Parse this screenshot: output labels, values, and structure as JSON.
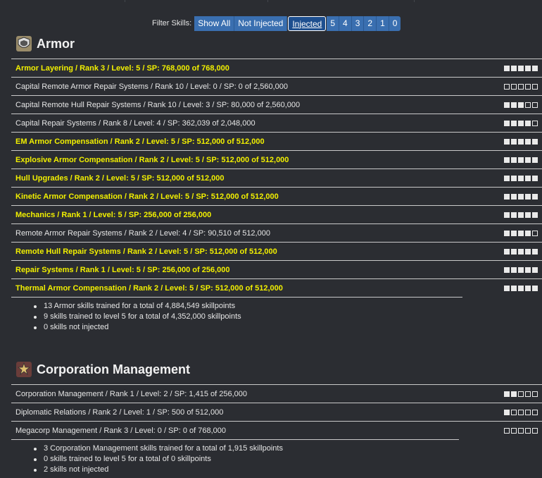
{
  "filter": {
    "label": "Filter Skills:",
    "buttons": [
      {
        "label": "Show All",
        "active": false
      },
      {
        "label": "Not Injected",
        "active": false
      },
      {
        "label": "Injected",
        "active": true
      },
      {
        "label": "5",
        "active": false
      },
      {
        "label": "4",
        "active": false
      },
      {
        "label": "3",
        "active": false
      },
      {
        "label": "2",
        "active": false
      },
      {
        "label": "1",
        "active": false
      },
      {
        "label": "0",
        "active": false
      }
    ]
  },
  "sections": [
    {
      "title": "Armor",
      "icon": "armor-plate-icon",
      "skills": [
        {
          "text": "Armor Layering / Rank 3 / Level: 5 / SP: 768,000 of 768,000",
          "level": 5,
          "complete": true
        },
        {
          "text": "Capital Remote Armor Repair Systems / Rank 10 / Level: 0 / SP: 0 of 2,560,000",
          "level": 0,
          "complete": false
        },
        {
          "text": "Capital Remote Hull Repair Systems / Rank 10 / Level: 3 / SP: 80,000 of 2,560,000",
          "level": 3,
          "complete": false
        },
        {
          "text": "Capital Repair Systems / Rank 8 / Level: 4 / SP: 362,039 of 2,048,000",
          "level": 4,
          "complete": false
        },
        {
          "text": "EM Armor Compensation / Rank 2 / Level: 5 / SP: 512,000 of 512,000",
          "level": 5,
          "complete": true
        },
        {
          "text": "Explosive Armor Compensation / Rank 2 / Level: 5 / SP: 512,000 of 512,000",
          "level": 5,
          "complete": true
        },
        {
          "text": "Hull Upgrades / Rank 2 / Level: 5 / SP: 512,000 of 512,000",
          "level": 5,
          "complete": true
        },
        {
          "text": "Kinetic Armor Compensation / Rank 2 / Level: 5 / SP: 512,000 of 512,000",
          "level": 5,
          "complete": true
        },
        {
          "text": "Mechanics / Rank 1 / Level: 5 / SP: 256,000 of 256,000",
          "level": 5,
          "complete": true
        },
        {
          "text": "Remote Armor Repair Systems / Rank 2 / Level: 4 / SP: 90,510 of 512,000",
          "level": 4,
          "complete": false
        },
        {
          "text": "Remote Hull Repair Systems / Rank 2 / Level: 5 / SP: 512,000 of 512,000",
          "level": 5,
          "complete": true
        },
        {
          "text": "Repair Systems / Rank 1 / Level: 5 / SP: 256,000 of 256,000",
          "level": 5,
          "complete": true
        },
        {
          "text": "Thermal Armor Compensation / Rank 2 / Level: 5 / SP: 512,000 of 512,000",
          "level": 5,
          "complete": true
        }
      ],
      "summary": [
        "13 Armor skills trained for a total of 4,884,549 skillpoints",
        "9 skills trained to level 5 for a total of 4,352,000 skillpoints",
        "0 skills not injected"
      ]
    },
    {
      "title": "Corporation Management",
      "icon": "corporation-star-icon",
      "skills": [
        {
          "text": "Corporation Management / Rank 1 / Level: 2 / SP: 1,415 of 256,000",
          "level": 2,
          "complete": false
        },
        {
          "text": "Diplomatic Relations / Rank 2 / Level: 1 / SP: 500 of 512,000",
          "level": 1,
          "complete": false
        },
        {
          "text": "Megacorp Management / Rank 3 / Level: 0 / SP: 0 of 768,000",
          "level": 0,
          "complete": false
        }
      ],
      "summary": [
        "3 Corporation Management skills trained for a total of 1,915 skillpoints",
        "0 skills trained to level 5 for a total of 0 skillpoints",
        "2 skills not injected"
      ]
    }
  ],
  "colors": {
    "background": "#2b2d32",
    "complete_text": "#f2f000",
    "button": "#3a6fb0",
    "rule": "#c9c9c9"
  }
}
